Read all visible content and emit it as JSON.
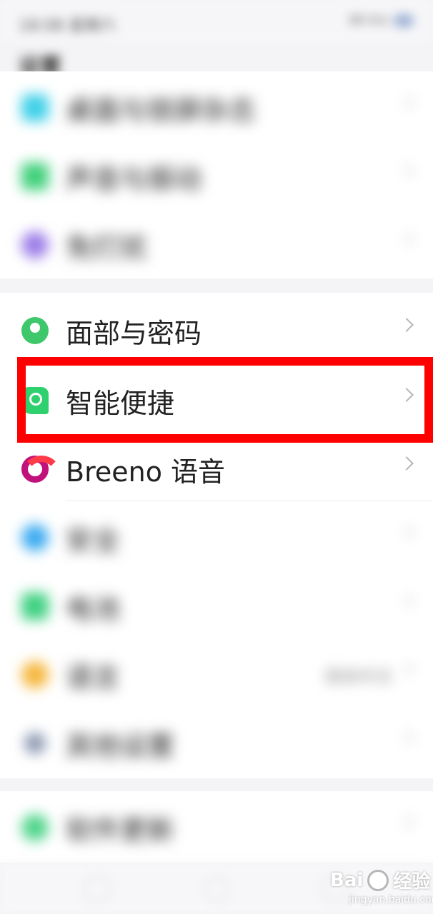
{
  "status_bar": {
    "time": "18:08 星期六",
    "speed": "88 K/s"
  },
  "page_title": "设置",
  "group1": [
    {
      "label": "桌面与锁屏杂志",
      "icon": "wallpaper-icon",
      "color": "#3fd0e8"
    },
    {
      "label": "声音与振动",
      "icon": "sound-icon",
      "color": "#3fd07a"
    },
    {
      "label": "免打扰",
      "icon": "moon-icon",
      "color": "#9b7ce8"
    }
  ],
  "group2": [
    {
      "label": "面部与密码",
      "icon": "face-icon",
      "color": "#3ec86b"
    },
    {
      "label": "智能便捷",
      "icon": "smart-assist-icon",
      "color": "#2fd06e"
    },
    {
      "label": "Breeno 语音",
      "icon": "breeno-icon",
      "color": "#c0127a"
    },
    {
      "label": "安全",
      "icon": "shield-icon",
      "color": "#3aaaf0"
    },
    {
      "label": "电池",
      "icon": "battery-icon",
      "color": "#3ed080"
    },
    {
      "label": "语言",
      "icon": "language-icon",
      "color": "#f6b63c",
      "value": "简体中文"
    },
    {
      "label": "其他设置",
      "icon": "more-settings-icon",
      "color": "#8a96b0"
    }
  ],
  "group3": [
    {
      "label": "软件更新",
      "icon": "update-icon",
      "color": "#4fd48a"
    }
  ],
  "watermark": {
    "text": "Bai",
    "text2": "经验",
    "sub": "jingyan.baidu.com"
  },
  "highlight_color": "#ff0000"
}
